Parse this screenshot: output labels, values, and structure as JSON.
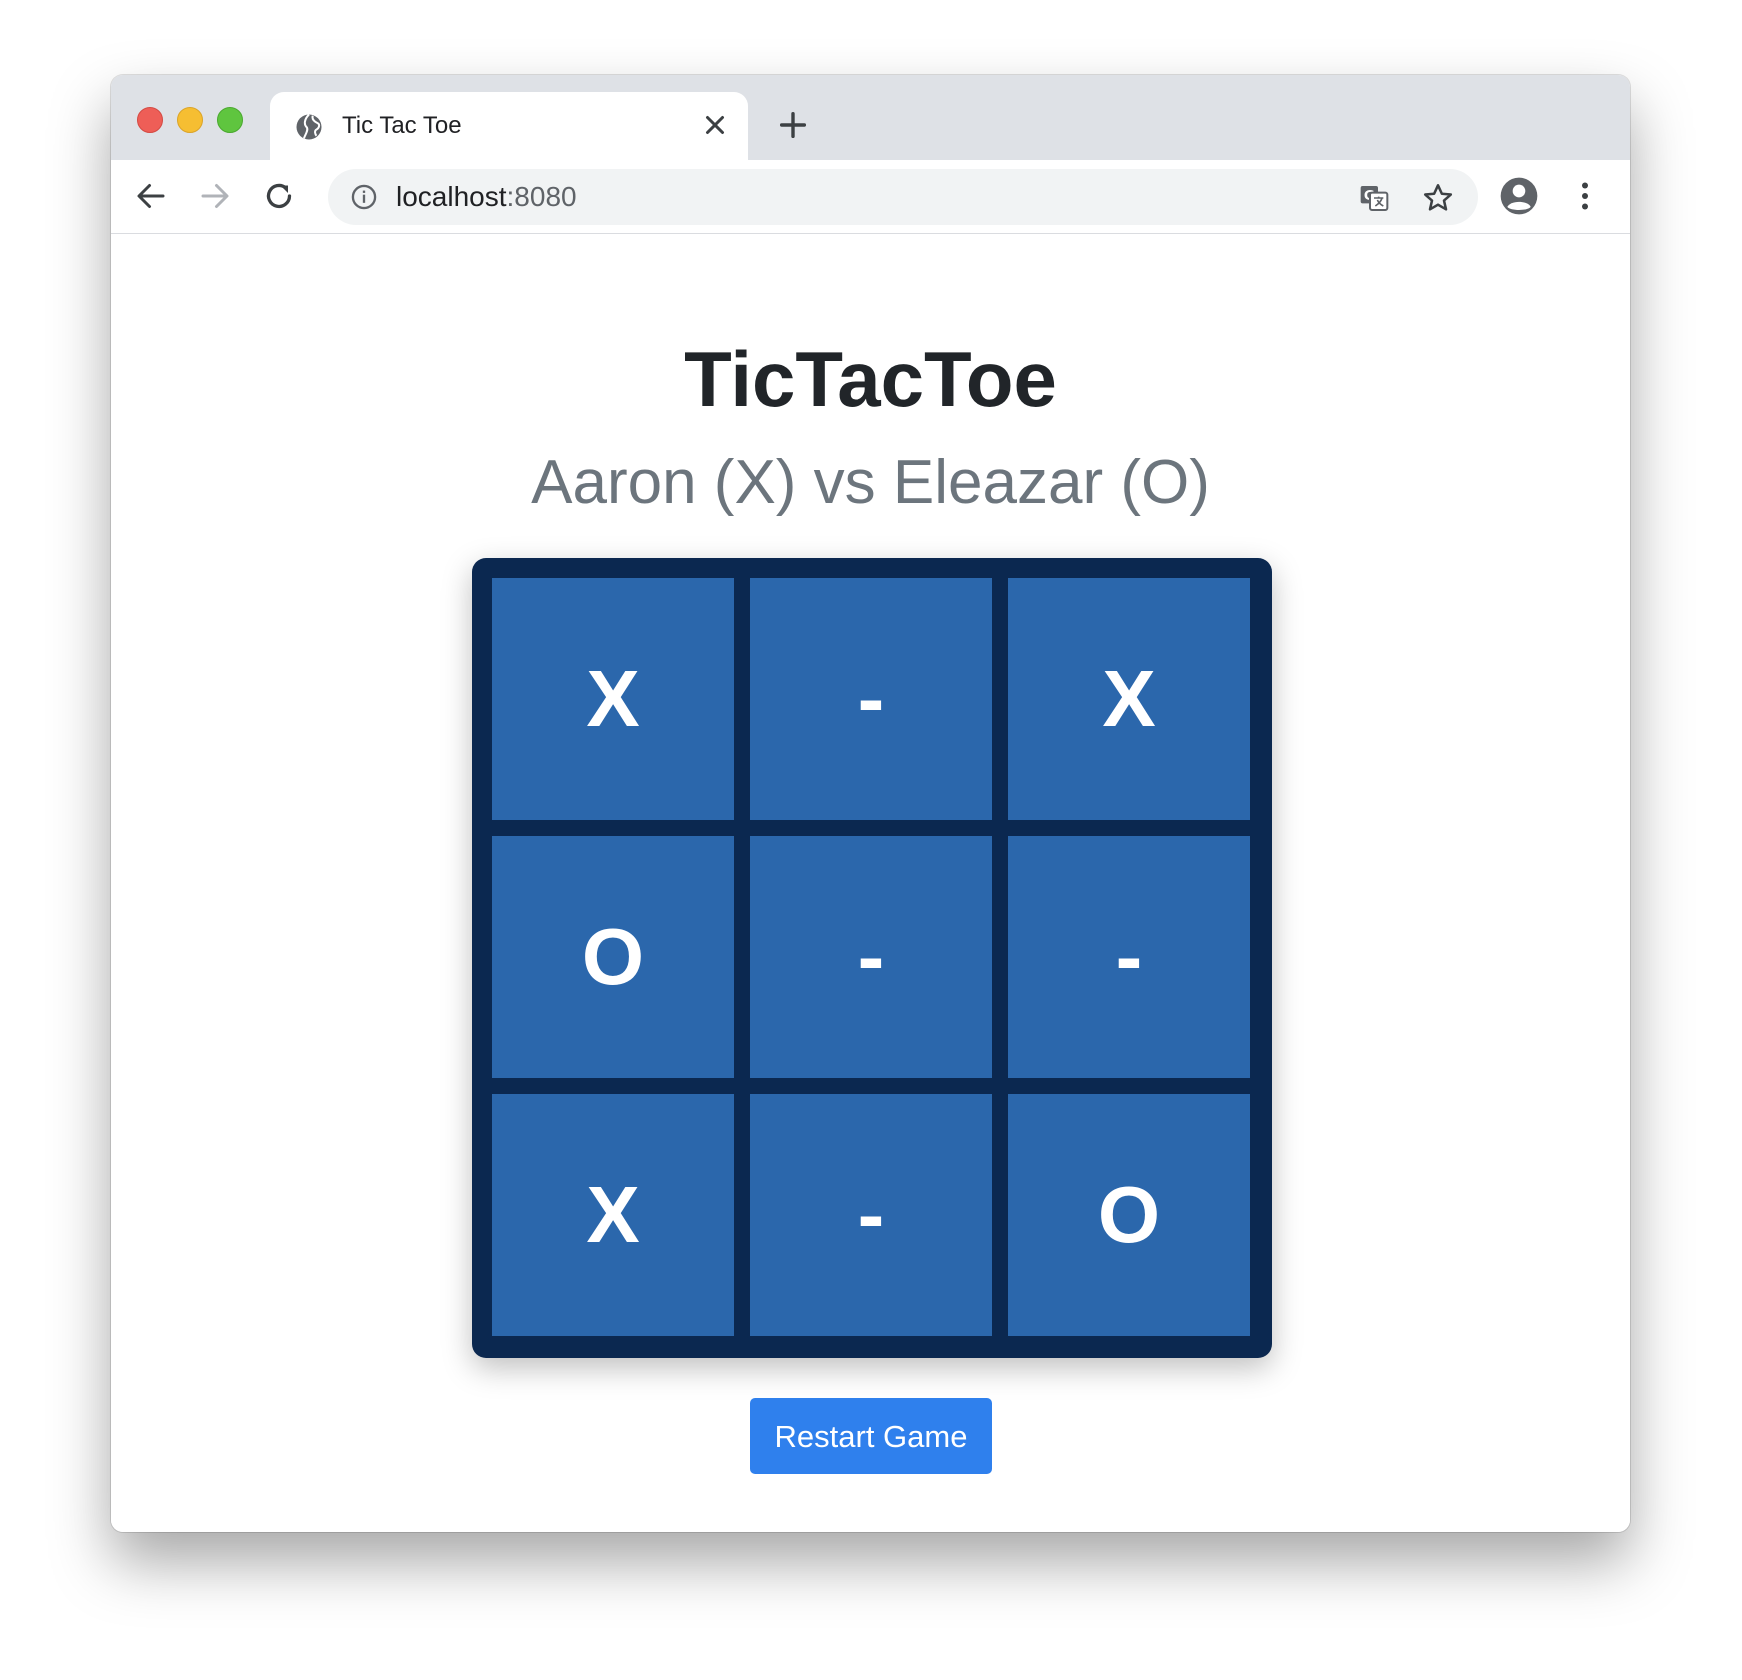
{
  "browser": {
    "tab_title": "Tic Tac Toe",
    "url_host": "localhost",
    "url_port": ":8080",
    "icons": {
      "favicon": "globe-icon",
      "tab_close": "close-icon",
      "new_tab": "plus-icon",
      "back": "back-arrow-icon",
      "forward": "forward-arrow-icon",
      "reload": "reload-icon",
      "site_info": "info-icon",
      "translate": "translate-icon",
      "bookmark": "star-icon",
      "profile": "account-icon",
      "menu": "more-vert-icon"
    }
  },
  "page": {
    "title": "TicTacToe",
    "subtitle": "Aaron (X) vs Eleazar (O)",
    "restart_label": "Restart Game"
  },
  "board": {
    "cells": [
      "X",
      "-",
      "X",
      "O",
      "-",
      "-",
      "X",
      "-",
      "O"
    ]
  },
  "colors": {
    "board_border": "#0b2850",
    "cell_background": "#2b67ac",
    "cell_text": "#ffffff",
    "button_background": "#2f80ed"
  }
}
